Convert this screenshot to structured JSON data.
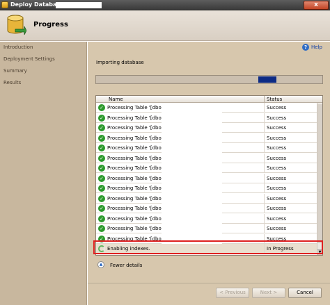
{
  "window": {
    "title": "Deploy Database",
    "close_glyph": "x"
  },
  "header": {
    "title": "Progress"
  },
  "sidebar": {
    "items": [
      {
        "label": "Introduction"
      },
      {
        "label": "Deployment Settings"
      },
      {
        "label": "Summary"
      },
      {
        "label": "Results"
      }
    ]
  },
  "help": {
    "icon_glyph": "?",
    "label": "Help"
  },
  "status": {
    "text": "Importing database"
  },
  "progress": {
    "chunk_fraction_start": 0.716,
    "chunk_fraction_width": 0.08,
    "color": "#0d2b85"
  },
  "grid": {
    "columns": {
      "name": "Name",
      "status": "Status"
    },
    "rows": [
      {
        "name": "Processing Table '[dbo].",
        "status": "Success",
        "state": "ok"
      },
      {
        "name": "Processing Table '[dbo].",
        "status": "Success",
        "state": "ok"
      },
      {
        "name": "Processing Table '[dbo].",
        "status": "Success",
        "state": "ok"
      },
      {
        "name": "Processing Table '[dbo].",
        "status": "Success",
        "state": "ok"
      },
      {
        "name": "Processing Table '[dbo].",
        "status": "Success",
        "state": "ok"
      },
      {
        "name": "Processing Table '[dbo].",
        "status": "Success",
        "state": "ok"
      },
      {
        "name": "Processing Table '[dbo].",
        "status": "Success",
        "state": "ok"
      },
      {
        "name": "Processing Table '[dbo].",
        "status": "Success",
        "state": "ok"
      },
      {
        "name": "Processing Table '[dbo].",
        "status": "Success",
        "state": "ok"
      },
      {
        "name": "Processing Table '[dbo].",
        "status": "Success",
        "state": "ok"
      },
      {
        "name": "Processing Table '[dbo].",
        "status": "Success",
        "state": "ok"
      },
      {
        "name": "Processing Table '[dbo].",
        "status": "Success",
        "state": "ok"
      },
      {
        "name": "Processing Table '[dbo].",
        "status": "Success",
        "state": "ok"
      },
      {
        "name": "Processing Table '[dbo].",
        "status": "Success",
        "state": "ok"
      },
      {
        "name": "Enabling indexes.",
        "status": "In Progress",
        "state": "progress"
      }
    ],
    "ok_glyph": "✓"
  },
  "details": {
    "label": "Fewer details",
    "icon_glyph": "▲"
  },
  "buttons": {
    "previous": "< Previous",
    "next": "Next >",
    "cancel": "Cancel"
  },
  "colors": {
    "sidebar": "#c8b79e",
    "content": "#d7c7ad",
    "highlight": "#de2020"
  }
}
